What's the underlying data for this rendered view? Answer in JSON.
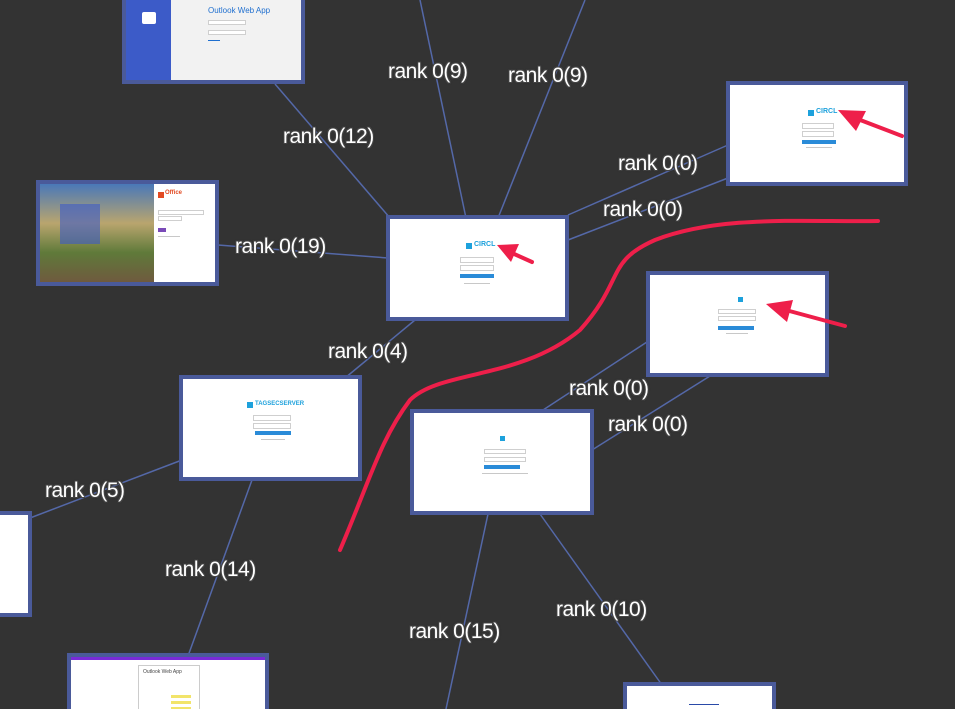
{
  "edges": [
    {
      "label": "rank 0(9)"
    },
    {
      "label": "rank 0(9)"
    },
    {
      "label": "rank 0(12)"
    },
    {
      "label": "rank 0(0)"
    },
    {
      "label": "rank 0(0)"
    },
    {
      "label": "rank 0(19)"
    },
    {
      "label": "rank 0(4)"
    },
    {
      "label": "rank 0(0)"
    },
    {
      "label": "rank 0(0)"
    },
    {
      "label": "rank 0(5)"
    },
    {
      "label": "rank 0(14)"
    },
    {
      "label": "rank 0(15)"
    },
    {
      "label": "rank 0(10)"
    }
  ],
  "nodes": {
    "outlook_top": {
      "title": "Outlook Web App"
    },
    "circl_right": {
      "title": "CIRCL"
    },
    "circl_center": {
      "title": "CIRCL"
    },
    "tagsecserver": {
      "title": "TAGSECSERVER"
    },
    "office_left": {
      "title": "Office"
    },
    "outlook_bottom": {
      "title": "Outlook Web App"
    }
  },
  "colors": {
    "background": "#333333",
    "node_border": "#4a5a9a",
    "edge": "#5468a8",
    "annotation": "#ee1f4a",
    "accent": "#1da1dc"
  }
}
